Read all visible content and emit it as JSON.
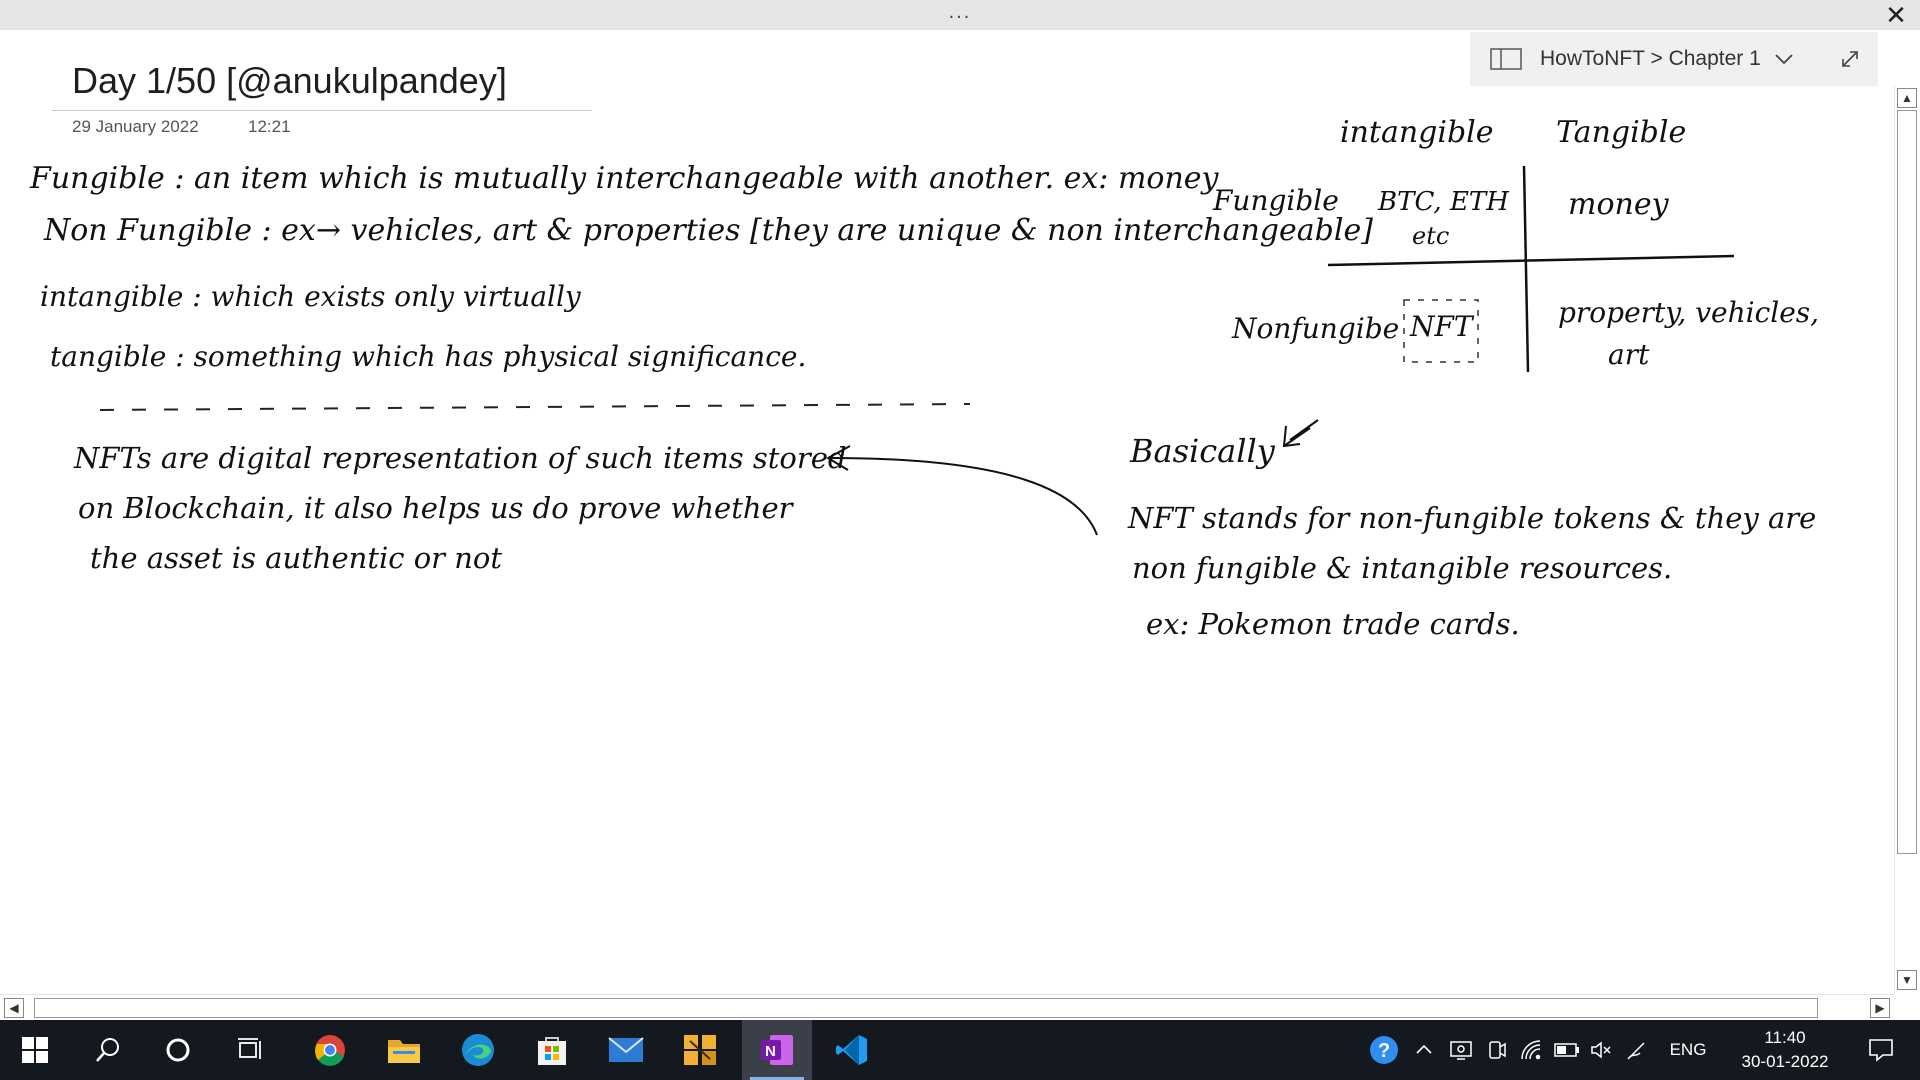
{
  "window": {
    "dots": "...",
    "close": "✕"
  },
  "notebook": {
    "label": "HowToNFT > Chapter 1"
  },
  "page": {
    "title": "Day 1/50 [@anukulpandey]",
    "date": "29 January 2022",
    "time": "12:21"
  },
  "notes": {
    "fungible": "Fungible : an item which is mutually interchangeable with another. ex: money",
    "non_fungible": "Non Fungible : ex→ vehicles, art & properties [they are unique & non interchangeable]",
    "intangible": "intangible : which exists only virtually",
    "tangible": "tangible : something which has physical significance.",
    "nft_line1": "NFTs are digital representation of such items stored",
    "nft_line2": "on Blockchain, it also helps us do prove whether",
    "nft_line3": "the asset is authentic or not",
    "basically": "Basically",
    "basic_line1": "NFT stands for non-fungible tokens & they are",
    "basic_line2": "non fungible & intangible resources.",
    "basic_line3": "ex: Pokemon trade cards."
  },
  "matrix": {
    "col_intangible": "intangible",
    "col_tangible": "Tangible",
    "row_fungible": "Fungible",
    "row_nonfungible": "Nonfungibe",
    "cell_fi_1": "BTC, ETH",
    "cell_fi_2": "etc",
    "cell_ft": "money",
    "cell_ni": "NFT",
    "cell_nt_1": "property, vehicles,",
    "cell_nt_2": "art"
  },
  "taskbar": {
    "apps": [
      "start-icon",
      "search-icon",
      "cortana-icon",
      "task-view-icon",
      "chrome-icon",
      "file-explorer-icon",
      "edge-icon",
      "store-icon",
      "mail-icon",
      "puzzle-app-icon",
      "onenote-icon",
      "vscode-icon"
    ],
    "language": "ENG",
    "time": "11:40",
    "date": "30-01-2022"
  }
}
